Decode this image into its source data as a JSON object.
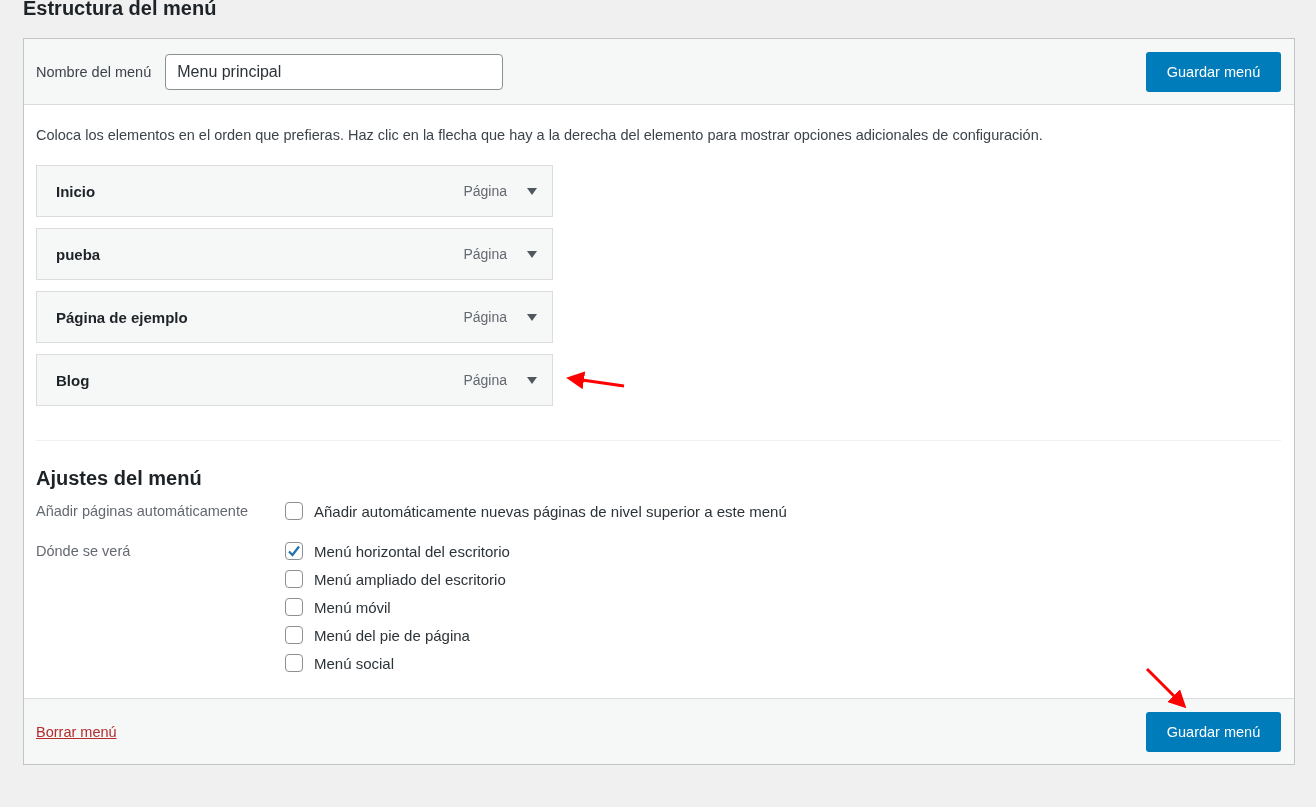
{
  "heading": "Estructura del menú",
  "menu_name": {
    "label": "Nombre del menú",
    "value": "Menu principal"
  },
  "header_save_button": "Guardar menú",
  "instructions": "Coloca los elementos en el orden que prefieras. Haz clic en la flecha que hay a la derecha del elemento para mostrar opciones adicionales de configuración.",
  "menu_items": [
    {
      "title": "Inicio",
      "type": "Página"
    },
    {
      "title": "pueba",
      "type": "Página"
    },
    {
      "title": "Página de ejemplo",
      "type": "Página"
    },
    {
      "title": "Blog",
      "type": "Página"
    }
  ],
  "settings": {
    "title": "Ajustes del menú",
    "groups": [
      {
        "label": "Añadir páginas automáticamente",
        "options": [
          {
            "label": "Añadir automáticamente nuevas páginas de nivel superior a este menú",
            "checked": false
          }
        ]
      },
      {
        "label": "Dónde se verá",
        "options": [
          {
            "label": "Menú horizontal del escritorio",
            "checked": true
          },
          {
            "label": "Menú ampliado del escritorio",
            "checked": false
          },
          {
            "label": "Menú móvil",
            "checked": false
          },
          {
            "label": "Menú del pie de página",
            "checked": false
          },
          {
            "label": "Menú social",
            "checked": false
          }
        ]
      }
    ]
  },
  "footer": {
    "delete_link": "Borrar menú",
    "save_button": "Guardar menú"
  }
}
